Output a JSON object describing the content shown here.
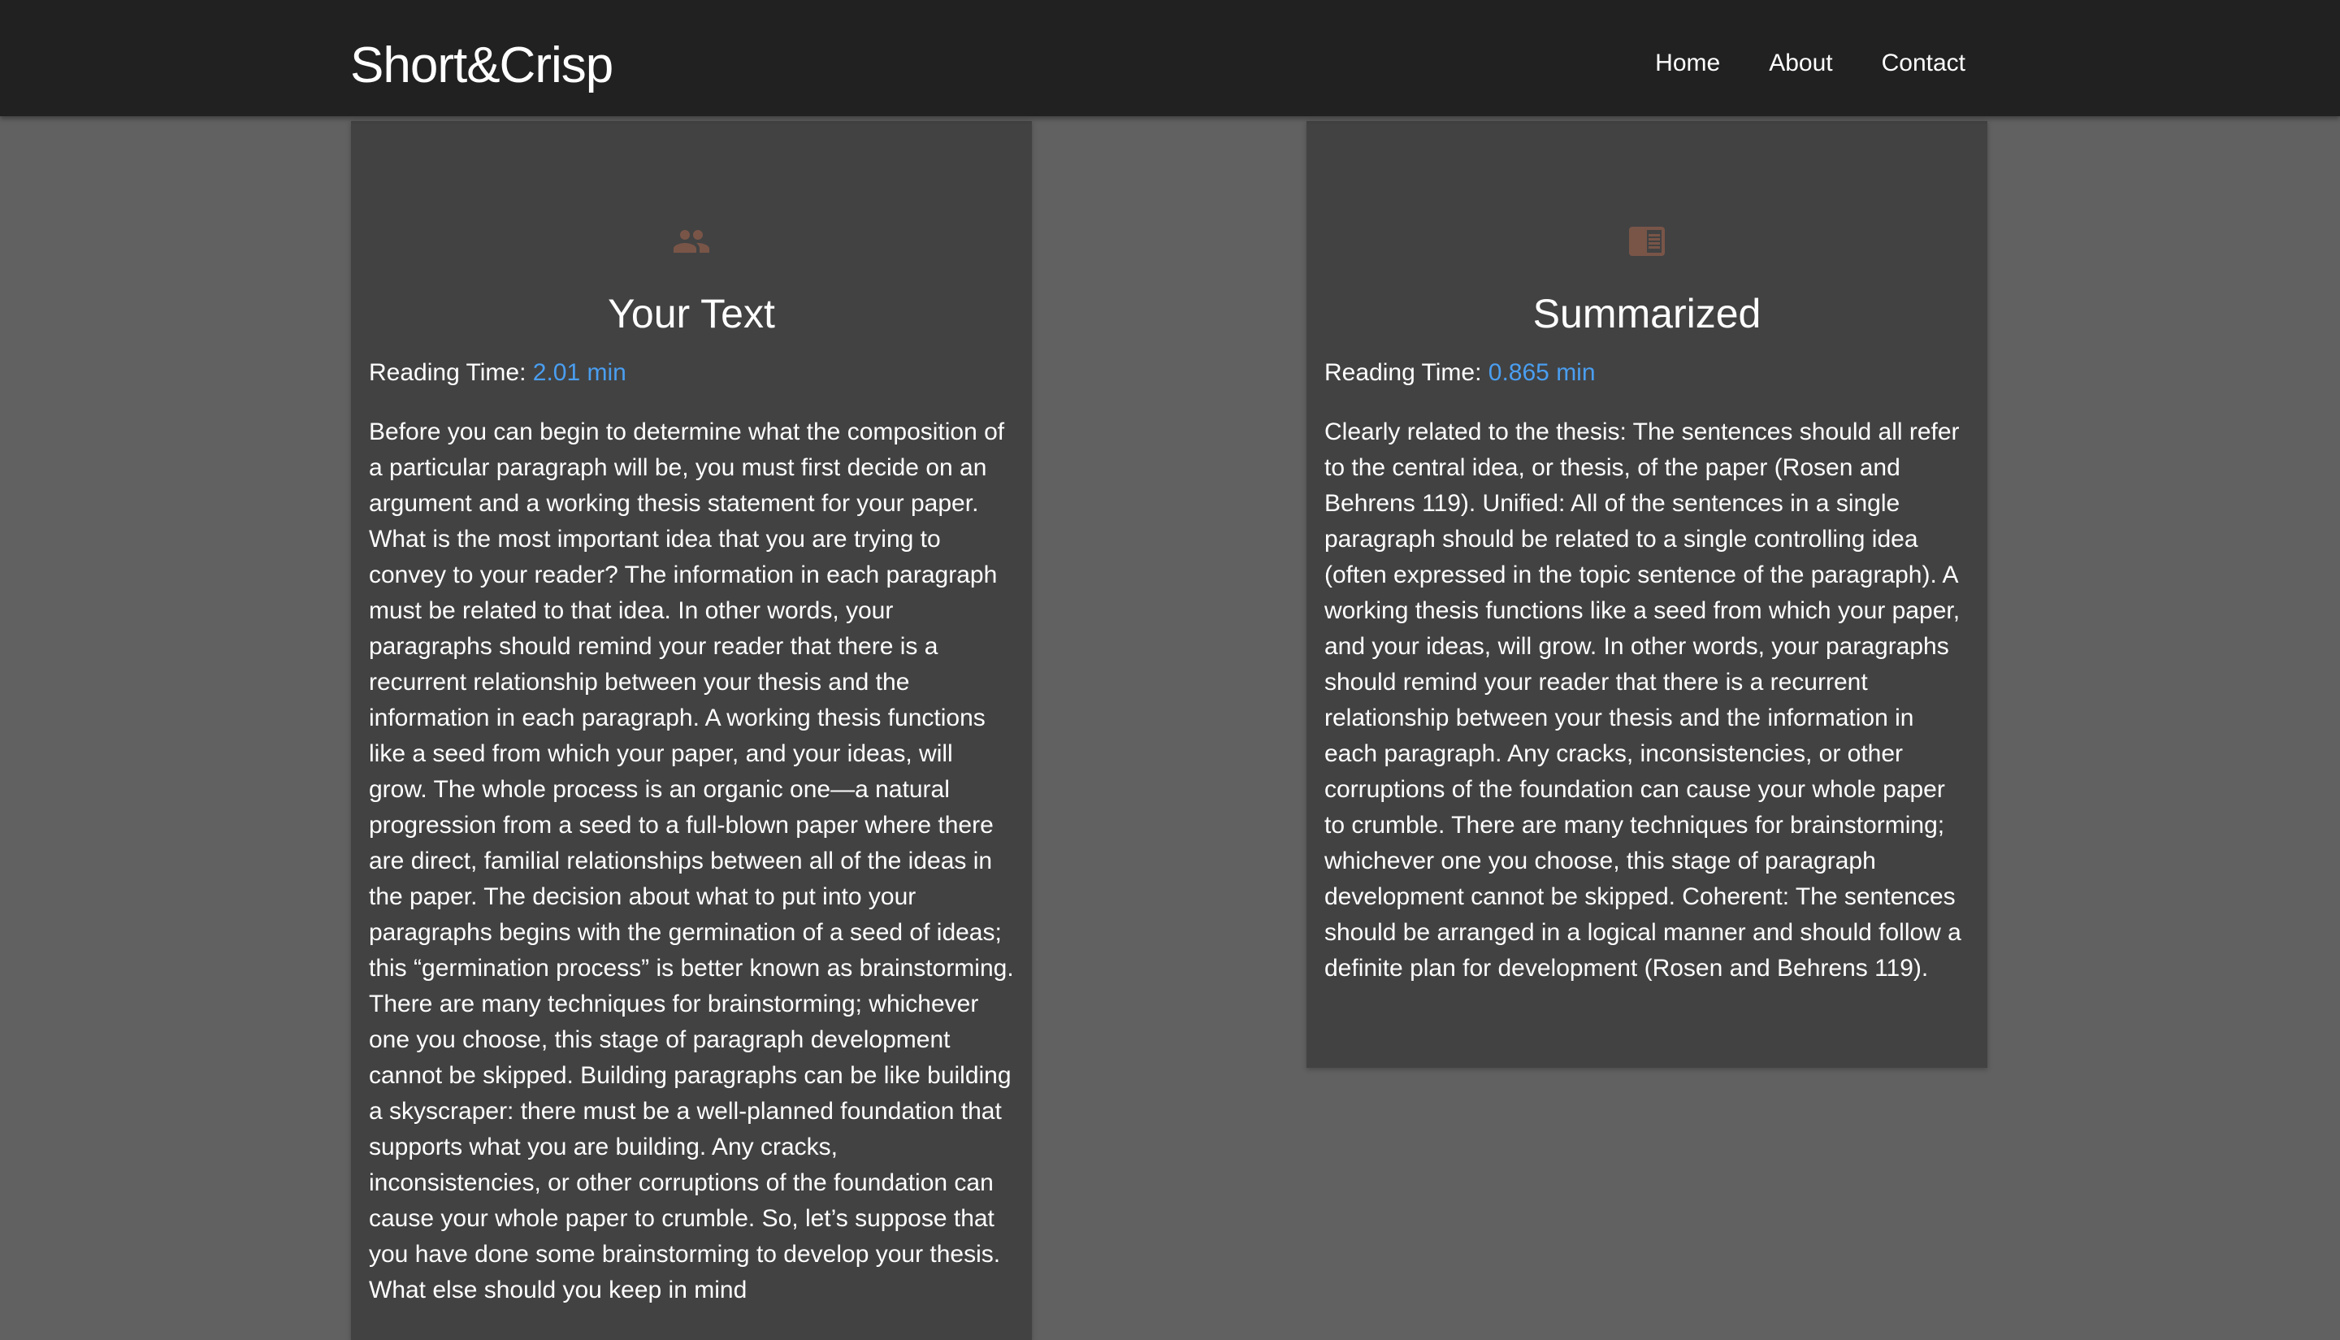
{
  "navbar": {
    "brand": "Short&Crisp",
    "links": [
      "Home",
      "About",
      "Contact"
    ]
  },
  "colors": {
    "page_background": "#616161",
    "navbar_background": "#212121",
    "card_background": "#424242",
    "icon_color": "#795548",
    "reading_time_value": "#4a9ef0"
  },
  "original": {
    "icon": "people-icon",
    "title": "Your Text",
    "reading_time_label": "Reading Time:",
    "reading_time_value": "2.01 min",
    "text": "Before you can begin to determine what the composition of a particular paragraph will be, you must first decide on an argument and a working thesis statement for your paper. What is the most important idea that you are trying to convey to your reader? The information in each paragraph must be related to that idea. In other words, your paragraphs should remind your reader that there is a recurrent relationship between your thesis and the information in each paragraph. A working thesis functions like a seed from which your paper, and your ideas, will grow. The whole process is an organic one—a natural progression from a seed to a full-blown paper where there are direct, familial relationships between all of the ideas in the paper. The decision about what to put into your paragraphs begins with the germination of a seed of ideas; this “germination process” is better known as brainstorming. There are many techniques for brainstorming; whichever one you choose, this stage of paragraph development cannot be skipped. Building paragraphs can be like building a skyscraper: there must be a well-planned foundation that supports what you are building. Any cracks, inconsistencies, or other corruptions of the foundation can cause your whole paper to crumble. So, let’s suppose that you have done some brainstorming to develop your thesis. What else should you keep in mind"
  },
  "summary": {
    "icon": "featured-article-icon",
    "title": "Summarized",
    "reading_time_label": "Reading Time:",
    "reading_time_value": "0.865 min",
    "text": "Clearly related to the thesis: The sentences should all refer to the central idea, or thesis, of the paper (Rosen and Behrens 119). Unified: All of the sentences in a single paragraph should be related to a single controlling idea (often expressed in the topic sentence of the paragraph). A working thesis functions like a seed from which your paper, and your ideas, will grow. In other words, your paragraphs should remind your reader that there is a recurrent relationship between your thesis and the information in each paragraph. Any cracks, inconsistencies, or other corruptions of the foundation can cause your whole paper to crumble. There are many techniques for brainstorming; whichever one you choose, this stage of paragraph development cannot be skipped. Coherent: The sentences should be arranged in a logical manner and should follow a definite plan for development (Rosen and Behrens 119)."
  }
}
